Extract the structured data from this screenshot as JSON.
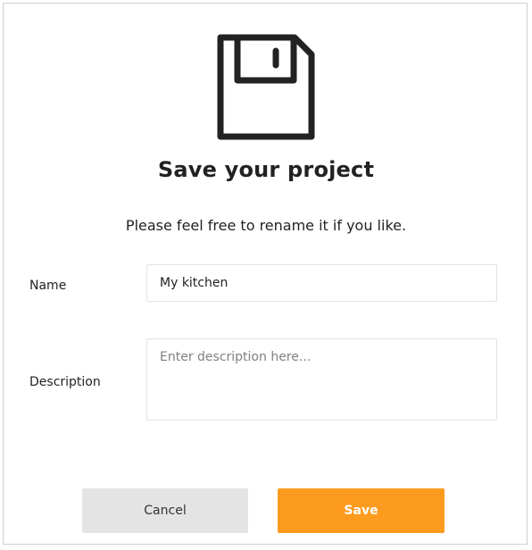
{
  "dialog": {
    "icon": "floppy-disk-icon",
    "title": "Save your project",
    "subtitle": "Please feel free to rename it if you like."
  },
  "form": {
    "name_label": "Name",
    "name_value": "My kitchen",
    "description_label": "Description",
    "description_value": "",
    "description_placeholder": "Enter description here..."
  },
  "buttons": {
    "cancel_label": "Cancel",
    "save_label": "Save"
  },
  "colors": {
    "accent": "#fd9b1e",
    "cancel_bg": "#e4e4e4",
    "text": "#222222",
    "border": "#cfcfcf"
  }
}
